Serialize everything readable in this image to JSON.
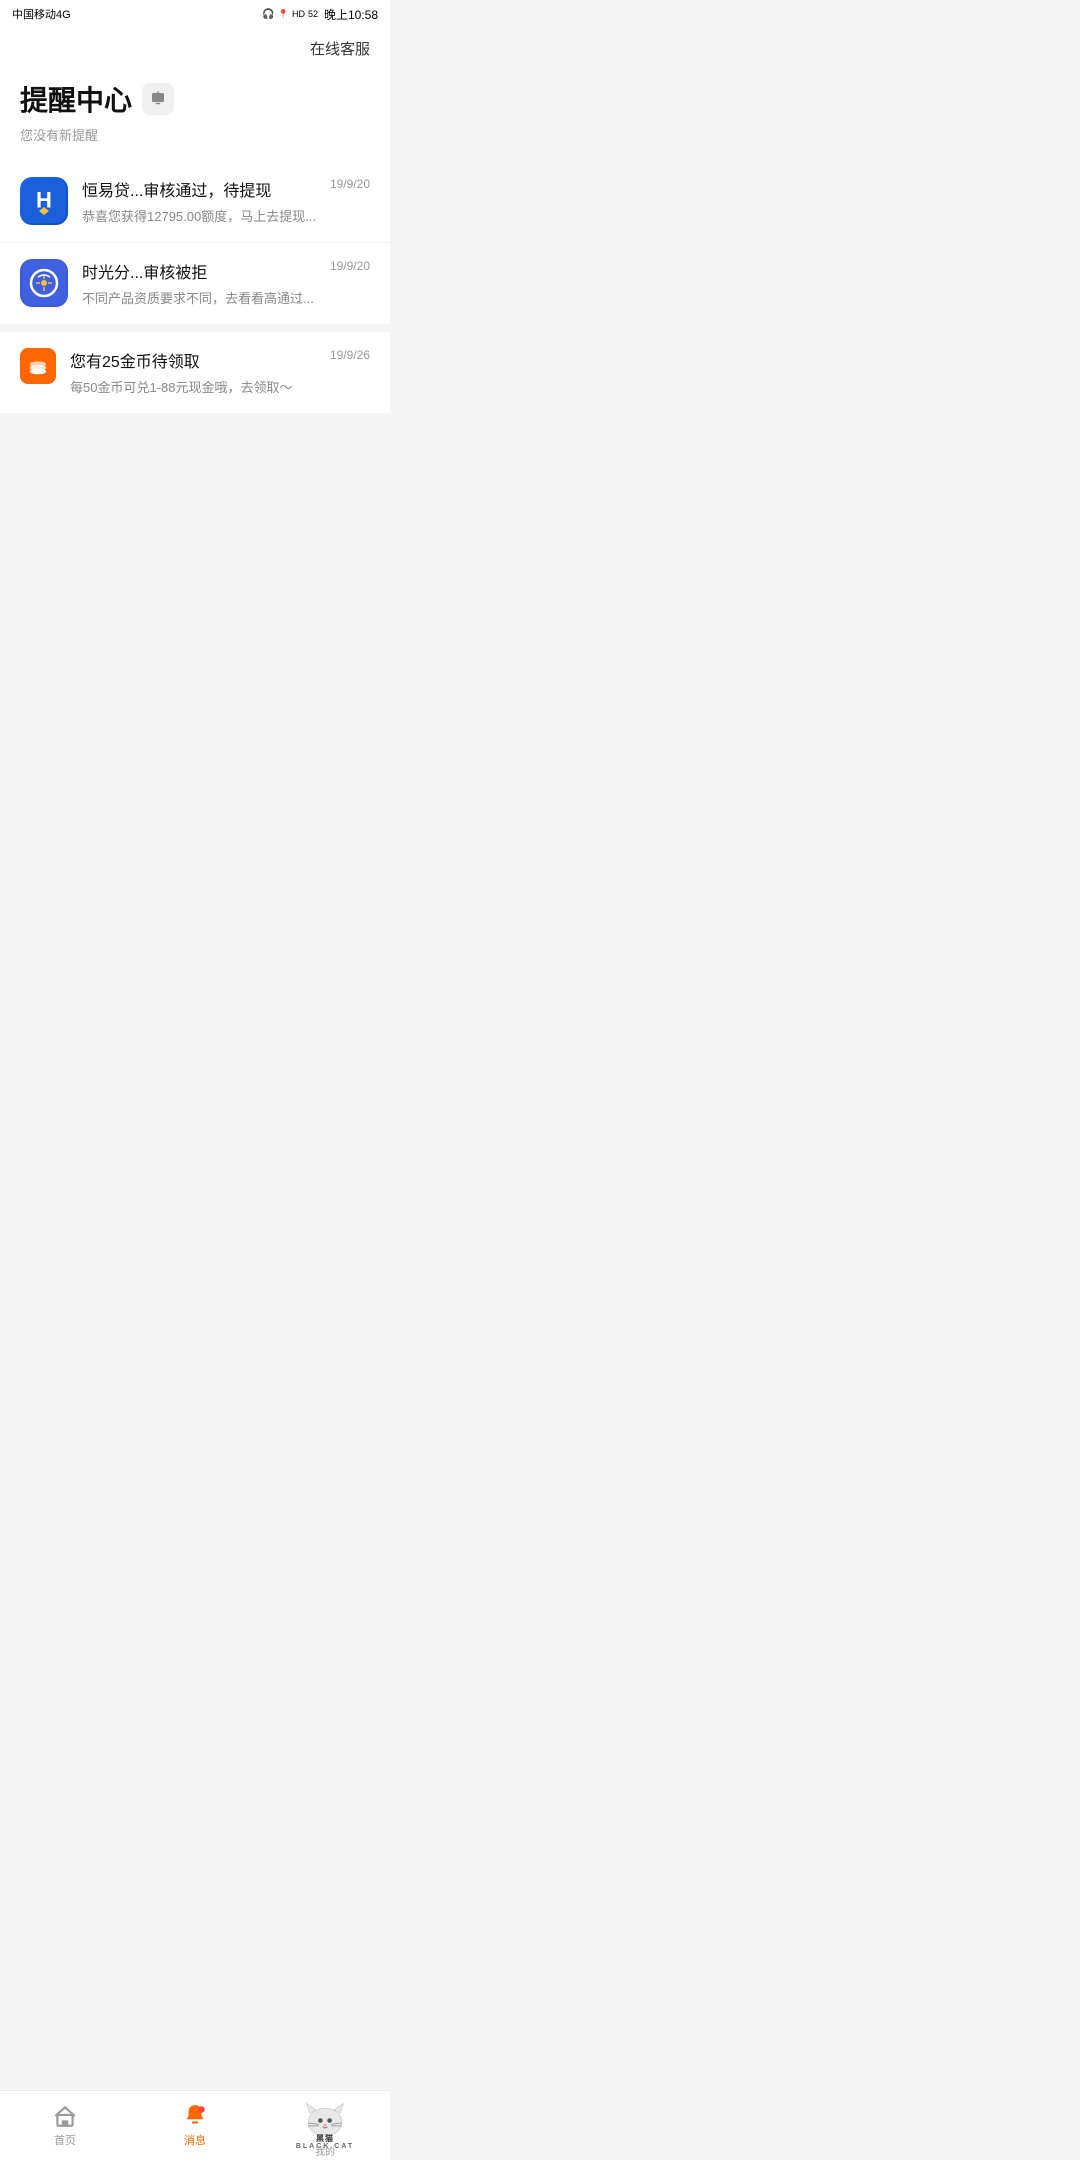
{
  "statusBar": {
    "carrier": "中国移动4G",
    "time": "晚上10:58",
    "battery": "52"
  },
  "header": {
    "onlineService": "在线客服"
  },
  "titleArea": {
    "title": "提醒中心",
    "noNotification": "您没有新提醒"
  },
  "notifications": [
    {
      "id": "henyi",
      "appName": "恒易贷",
      "title": "恒易贷...审核通过，待提现",
      "desc": "恭喜您获得12795.00额度，马上去提现...",
      "date": "19/9/20",
      "iconType": "henyi"
    },
    {
      "id": "shiguang",
      "appName": "时光分",
      "title": "时光分...审核被拒",
      "desc": "不同产品资质要求不同，去看看高通过...",
      "date": "19/9/20",
      "iconType": "shiguang"
    }
  ],
  "coinNotification": {
    "title": "您有25金币待领取",
    "desc": "每50金币可兑1-88元现金哦，去领取～",
    "date": "19/9/26"
  },
  "bottomNav": {
    "items": [
      {
        "id": "home",
        "label": "首页",
        "active": false
      },
      {
        "id": "message",
        "label": "消息",
        "active": true
      },
      {
        "id": "mine",
        "label": "我的",
        "active": false
      }
    ]
  },
  "blackcat": {
    "text": "BLACK CAT"
  }
}
